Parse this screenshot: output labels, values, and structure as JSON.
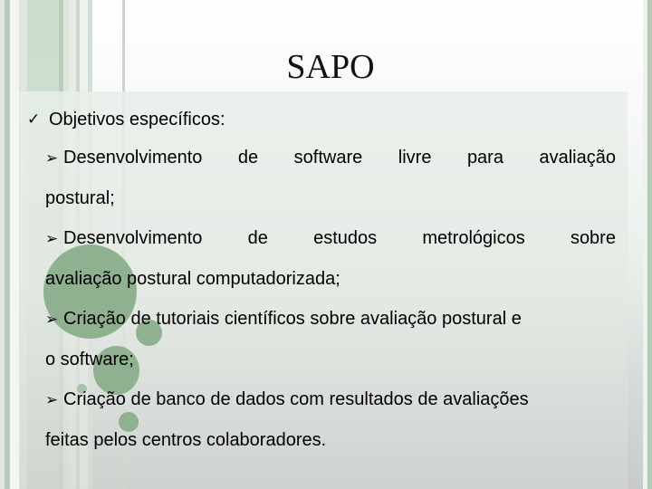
{
  "slide": {
    "title": "SAPO",
    "heading": {
      "icon": "check-icon",
      "icon_glyph": "✓",
      "text": "Objetivos específicos:"
    },
    "items": [
      {
        "icon": "arrow-bullet-icon",
        "icon_glyph": "➢",
        "line1_words": [
          "Desenvolvimento",
          "de",
          "software",
          "livre",
          "para",
          "avaliação"
        ],
        "line2": "postural;"
      },
      {
        "icon": "arrow-bullet-icon",
        "icon_glyph": "➢",
        "line1_words": [
          "Desenvolvimento",
          "de",
          "estudos",
          "metrológicos",
          "sobre"
        ],
        "line2": "avaliação postural computadorizada;"
      },
      {
        "icon": "arrow-bullet-icon",
        "icon_glyph": "➢",
        "line1": "Criação de tutoriais científicos sobre avaliação postural e",
        "line2": "o software;"
      },
      {
        "icon": "arrow-bullet-icon",
        "icon_glyph": "➢",
        "line1": "Criação de banco de dados com resultados de avaliações",
        "line2": "feitas pelos centros colaboradores."
      }
    ]
  },
  "theme": {
    "accent_green": "#8fb190",
    "stripe_green": "#b2c9b4",
    "panel_tint": "#e9efea"
  }
}
